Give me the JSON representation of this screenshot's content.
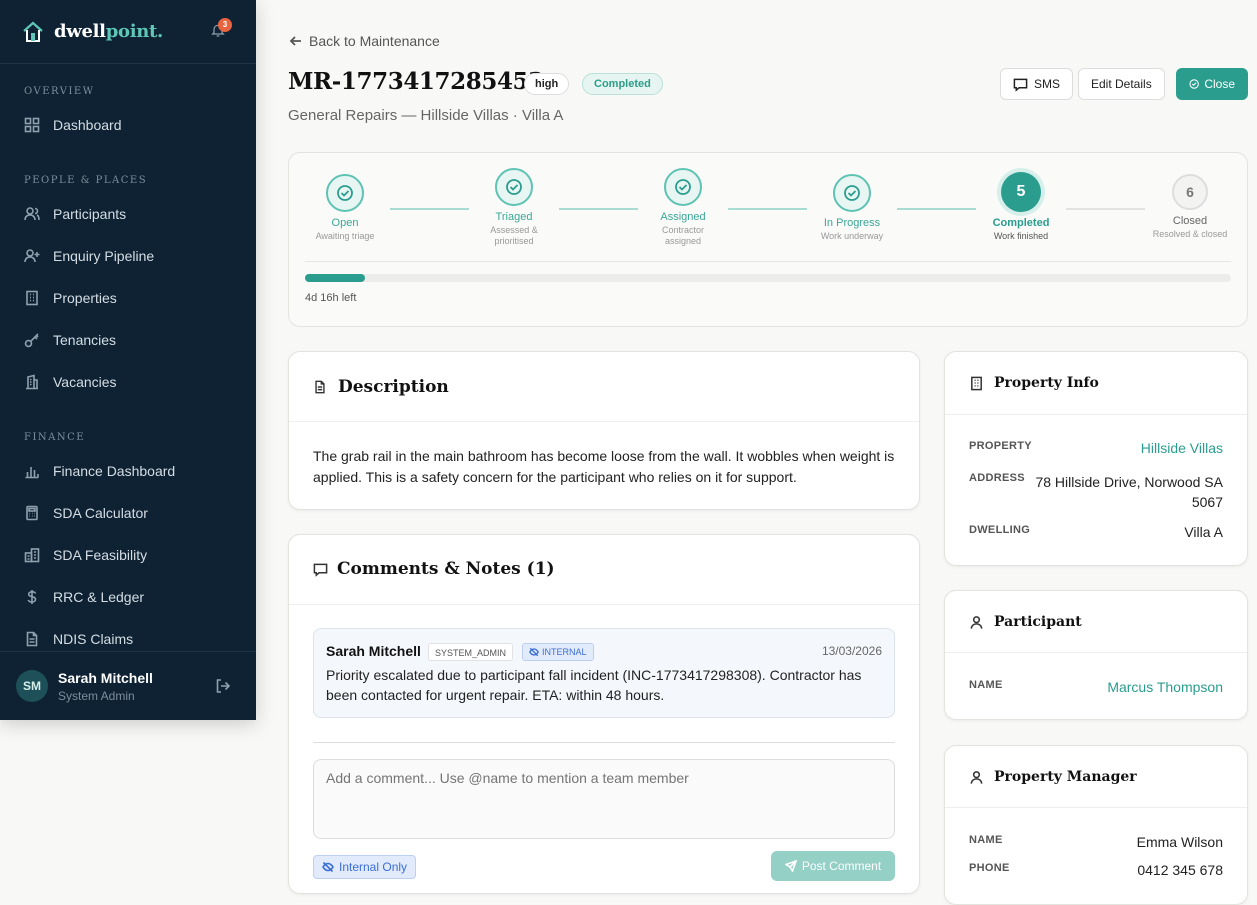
{
  "sidebar": {
    "brand_prefix": "dwell",
    "brand_accent": "point.",
    "notification_count": "3",
    "sections": {
      "overview": "OVERVIEW",
      "people": "PEOPLE & PLACES",
      "finance": "FINANCE"
    },
    "items": {
      "dashboard": "Dashboard",
      "participants": "Participants",
      "enquiry": "Enquiry Pipeline",
      "properties": "Properties",
      "tenancies": "Tenancies",
      "vacancies": "Vacancies",
      "finance_dashboard": "Finance Dashboard",
      "sda_calculator": "SDA Calculator",
      "sda_feasibility": "SDA Feasibility",
      "rrc_ledger": "RRC & Ledger",
      "ndis_claims": "NDIS Claims"
    },
    "user": {
      "initials": "SM",
      "name": "Sarah Mitchell",
      "role": "System Admin"
    }
  },
  "header": {
    "back_label": "Back to Maintenance",
    "title": "MR-1773417285453",
    "priority": "high",
    "status": "Completed",
    "subtitle": "General Repairs — Hillside Villas · Villa A",
    "sms_label": "SMS",
    "edit_label": "Edit Details",
    "close_label": "Close"
  },
  "stepper": {
    "steps": [
      {
        "label": "Open",
        "sub": "Awaiting triage",
        "state": "done"
      },
      {
        "label": "Triaged",
        "sub": "Assessed & prioritised",
        "state": "done"
      },
      {
        "label": "Assigned",
        "sub": "Contractor assigned",
        "state": "done"
      },
      {
        "label": "In Progress",
        "sub": "Work underway",
        "state": "done"
      },
      {
        "label": "Completed",
        "sub": "Work finished",
        "state": "current",
        "number": "5"
      },
      {
        "label": "Closed",
        "sub": "Resolved & closed",
        "state": "todo",
        "number": "6"
      }
    ],
    "progress_fraction": 0.065,
    "time_left": "4d 16h left"
  },
  "description": {
    "heading": "Description",
    "text": "The grab rail in the main bathroom has become loose from the wall. It wobbles when weight is applied. This is a safety concern for the participant who relies on it for support."
  },
  "comments": {
    "heading": "Comments & Notes (1)",
    "items": [
      {
        "author": "Sarah Mitchell",
        "role": "SYSTEM_ADMIN",
        "visibility": "INTERNAL",
        "date": "13/03/2026",
        "text": "Priority escalated due to participant fall incident (INC-1773417298308). Contractor has been contacted for urgent repair. ETA: within 48 hours."
      }
    ],
    "input_placeholder": "Add a comment... Use @name to mention a team member",
    "internal_toggle": "Internal Only",
    "post_label": "Post Comment"
  },
  "property_info": {
    "heading": "Property Info",
    "property_label": "PROPERTY",
    "property_value": "Hillside Villas",
    "address_label": "ADDRESS",
    "address_line1": "78 Hillside Drive, Norwood SA",
    "address_line2": "5067",
    "dwelling_label": "DWELLING",
    "dwelling_value": "Villa A"
  },
  "participant": {
    "heading": "Participant",
    "name_label": "NAME",
    "name_value": "Marcus Thompson"
  },
  "manager": {
    "heading": "Property Manager",
    "name_label": "NAME",
    "name_value": "Emma Wilson",
    "phone_label": "PHONE",
    "phone_value": "0412 345 678"
  },
  "colors": {
    "accent": "#2a9d8f",
    "sidebar_bg": "#0e2233",
    "badge": "#e8643f"
  }
}
